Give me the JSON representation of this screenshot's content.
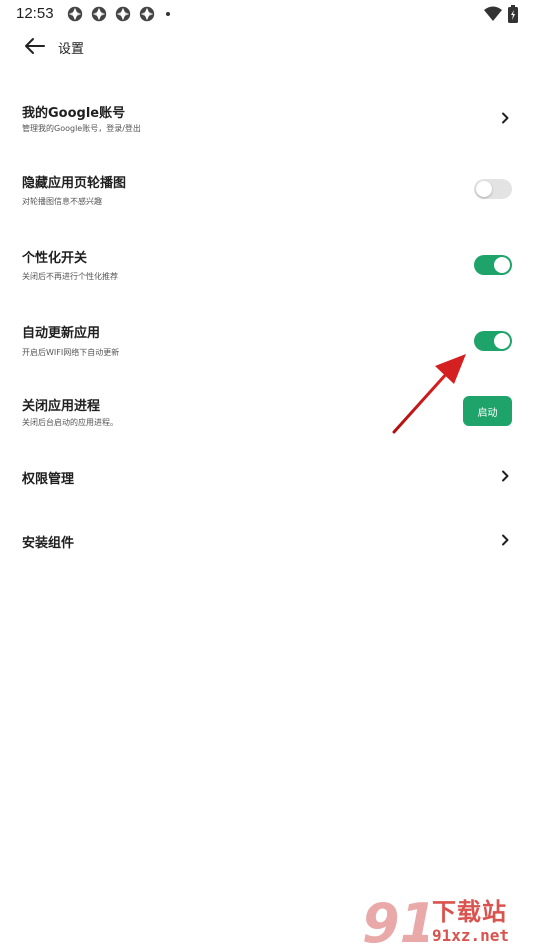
{
  "status_bar": {
    "time": "12:53",
    "notification_icons": [
      "app-notification-icon",
      "app-notification-icon",
      "app-notification-icon",
      "app-notification-icon"
    ],
    "right_icons": [
      "wifi-icon",
      "battery-charging-icon"
    ]
  },
  "app_bar": {
    "back_icon": "arrow-left-icon",
    "title": "设置"
  },
  "settings": [
    {
      "title": "我的Google账号",
      "subtitle": "管理我的Google账号，登录/登出",
      "control": "chevron"
    },
    {
      "title": "隐藏应用页轮播图",
      "subtitle": "对轮播图信息不感兴趣",
      "control": "toggle",
      "enabled": false
    },
    {
      "title": "个性化开关",
      "subtitle": "关闭后不再进行个性化推荐",
      "control": "toggle",
      "enabled": true
    },
    {
      "title": "自动更新应用",
      "subtitle": "开启后WIFI网络下自动更新",
      "control": "toggle",
      "enabled": true
    },
    {
      "title": "关闭应用进程",
      "subtitle": "关闭后台启动的应用进程。",
      "control": "button",
      "button_label": "启动"
    },
    {
      "title": "权限管理",
      "control": "chevron"
    },
    {
      "title": "安装组件",
      "control": "chevron"
    }
  ],
  "colors": {
    "accent": "#1ea36b",
    "toggle_off": "#e3e3e3",
    "annotation_arrow": "#d42020",
    "watermark": "#d9534f"
  },
  "watermark": {
    "chinese": "下载站",
    "url": "91xz.net"
  }
}
